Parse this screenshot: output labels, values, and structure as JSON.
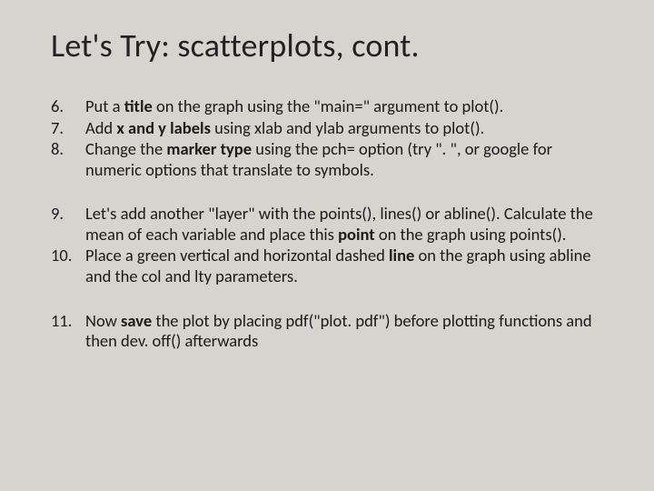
{
  "title": "Let's Try: scatterplots, cont.",
  "blocks": [
    {
      "items": [
        {
          "n": "6.",
          "html": "Put a <b>title</b> on the graph using the \"main=\" argument to plot()."
        },
        {
          "n": "7.",
          "html": "Add <b>x and y labels</b> using xlab and ylab arguments to plot()."
        },
        {
          "n": "8.",
          "html": "Change the <b>marker type</b> using the pch= option (try \". \", or google for numeric options that translate to symbols."
        }
      ]
    },
    {
      "items": [
        {
          "n": "9.",
          "html": "Let's add another \"layer\" with the points(), lines() or abline(). Calculate the mean of each variable and place this <b>point</b> on the graph using points()."
        },
        {
          "n": "10.",
          "html": "Place a green vertical and horizontal dashed <b>line</b> on the graph using abline and the col and lty parameters."
        }
      ]
    },
    {
      "items": [
        {
          "n": "11.",
          "html": "Now <b>save</b> the plot by placing pdf(\"plot. pdf\") before plotting functions and then dev. off() afterwards"
        }
      ]
    }
  ]
}
